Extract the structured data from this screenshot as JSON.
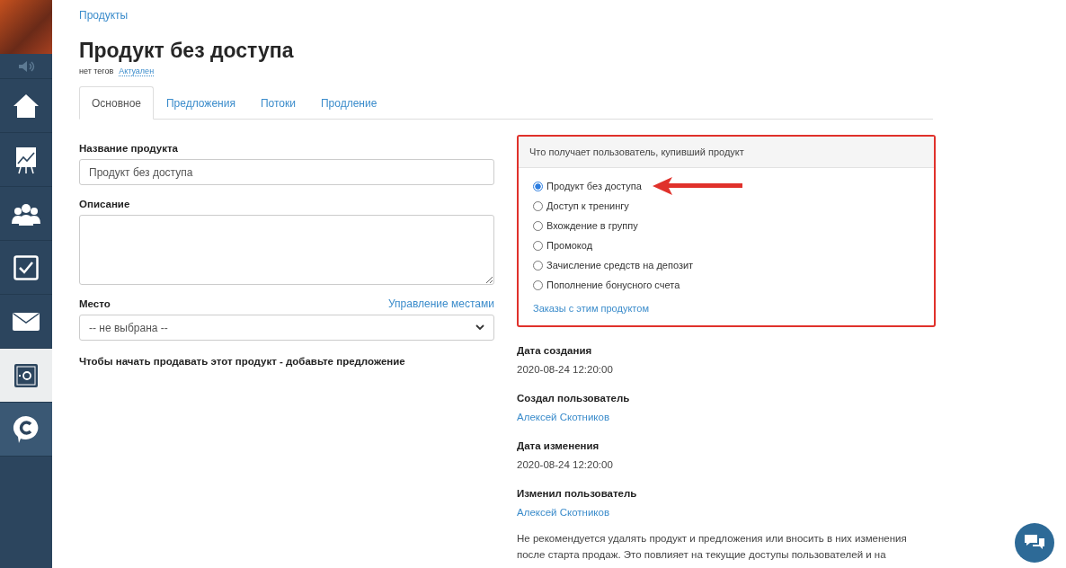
{
  "sidebar": {
    "items": [
      {
        "kind": "speaker",
        "selected": false
      },
      {
        "kind": "home",
        "selected": false
      },
      {
        "kind": "chart",
        "selected": false
      },
      {
        "kind": "people",
        "selected": false
      },
      {
        "kind": "check",
        "selected": false
      },
      {
        "kind": "mail",
        "selected": false
      },
      {
        "kind": "safe",
        "selected": true
      },
      {
        "kind": "chat",
        "selected": false
      }
    ]
  },
  "breadcrumb": "Продукты",
  "title": "Продукт без доступа",
  "tags": {
    "label": "нет тегов",
    "status": "Актуален"
  },
  "tabs": [
    {
      "label": "Основное",
      "selected": true
    },
    {
      "label": "Предложения",
      "selected": false
    },
    {
      "label": "Потоки",
      "selected": false
    },
    {
      "label": "Продление",
      "selected": false
    }
  ],
  "form": {
    "name_label": "Название продукта",
    "name_value": "Продукт без доступа",
    "description_label": "Описание",
    "place_label": "Место",
    "place_link": "Управление местами",
    "place_value": "-- не выбрана --",
    "hint": "Чтобы начать продавать этот продукт - добавьте предложение"
  },
  "access_panel": {
    "title": "Что получает пользователь, купивший продукт",
    "options": [
      {
        "label": "Продукт без доступа",
        "selected": true
      },
      {
        "label": "Доступ к тренингу",
        "selected": false
      },
      {
        "label": "Вхождение в группу",
        "selected": false
      },
      {
        "label": "Промокод",
        "selected": false
      },
      {
        "label": "Зачисление средств на депозит",
        "selected": false
      },
      {
        "label": "Пополнение бонусного счета",
        "selected": false
      }
    ],
    "link": "Заказы с этим продуктом"
  },
  "meta": [
    {
      "label": "Дата создания",
      "value": "2020-08-24 12:20:00",
      "kind": "text"
    },
    {
      "label": "Создал пользователь",
      "value": "Алексей Скотников",
      "kind": "link"
    },
    {
      "label": "Дата изменения",
      "value": "2020-08-24 12:20:00",
      "kind": "text"
    },
    {
      "label": "Изменил пользователь",
      "value": "Алексей Скотников",
      "kind": "link"
    }
  ],
  "warning": "Не рекомендуется удалять продукт и предложения или вносить в них изменения после старта продаж. Это повлияет на текущие доступы пользователей и на"
}
